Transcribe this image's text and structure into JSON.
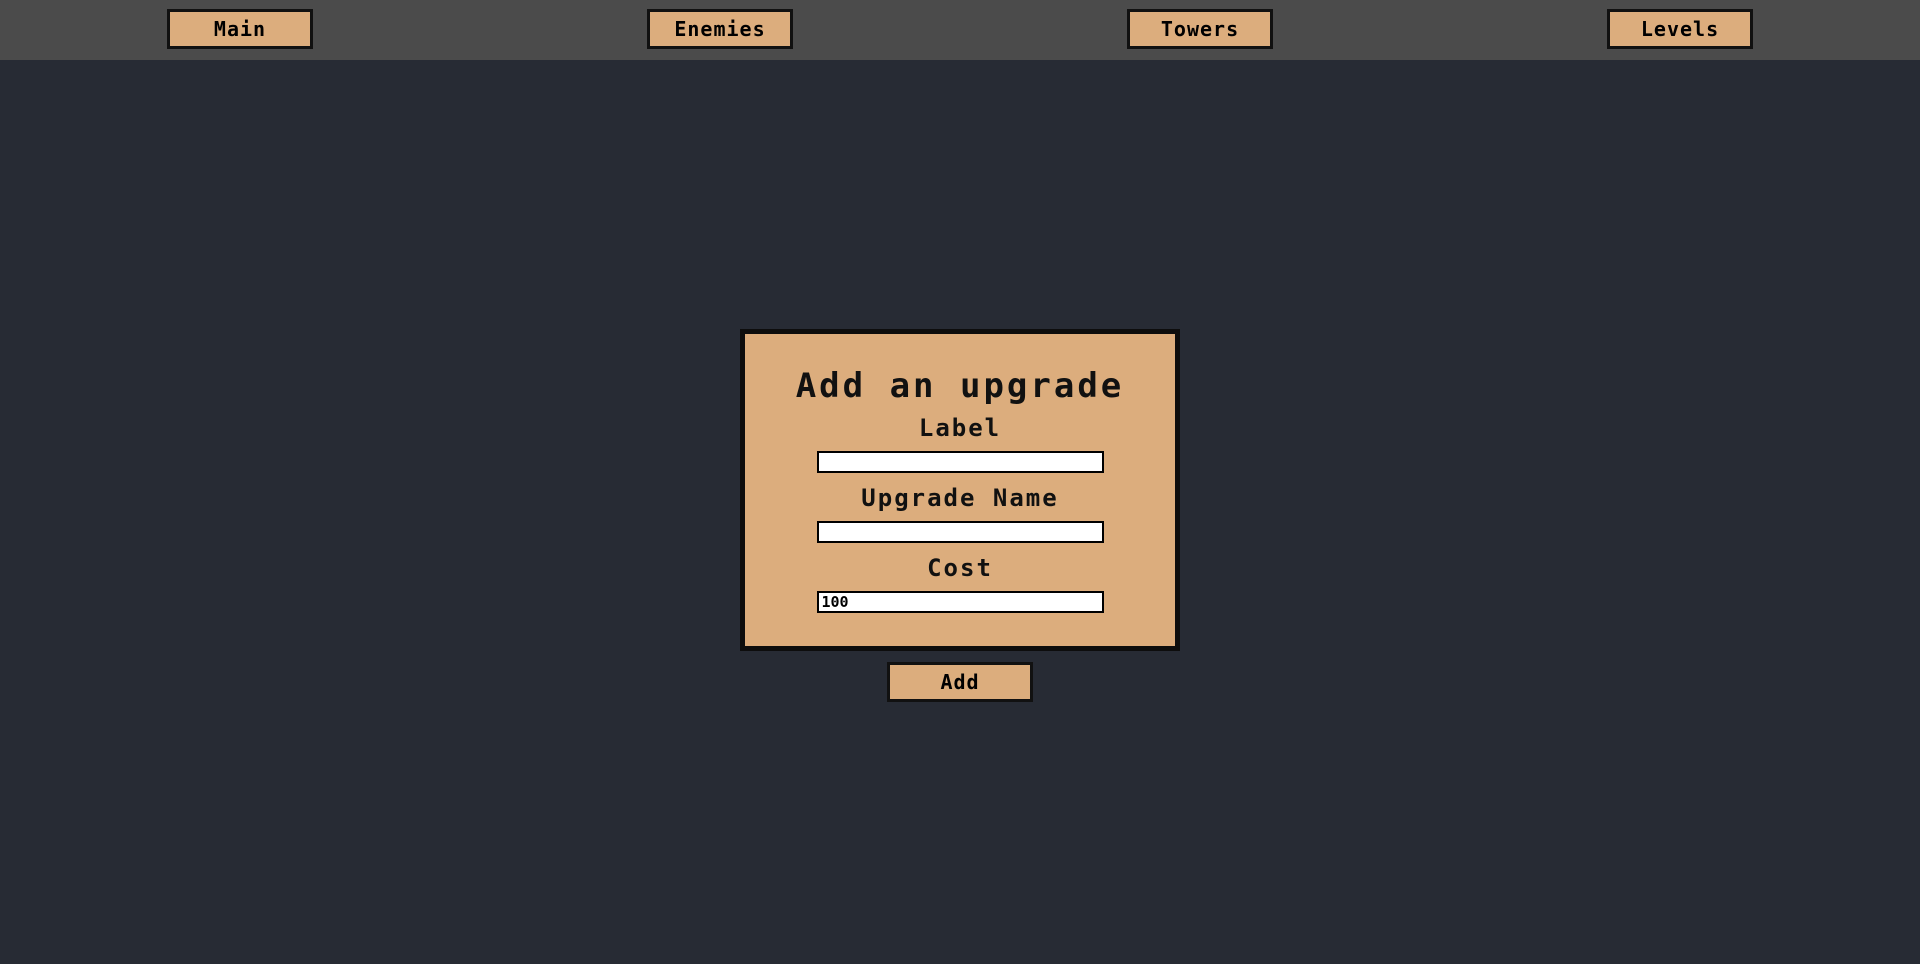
{
  "nav": {
    "items": [
      {
        "label": "Main"
      },
      {
        "label": "Enemies"
      },
      {
        "label": "Towers"
      },
      {
        "label": "Levels"
      }
    ]
  },
  "form": {
    "title": "Add an upgrade",
    "label_field": {
      "label": "Label",
      "value": ""
    },
    "upgrade_name_field": {
      "label": "Upgrade Name",
      "value": ""
    },
    "cost_field": {
      "label": "Cost",
      "value": "100"
    },
    "submit_label": "Add"
  },
  "colors": {
    "background": "#272b34",
    "nav_bar": "#4b4b4b",
    "button_fill": "#dcad7d",
    "border": "#111111"
  }
}
